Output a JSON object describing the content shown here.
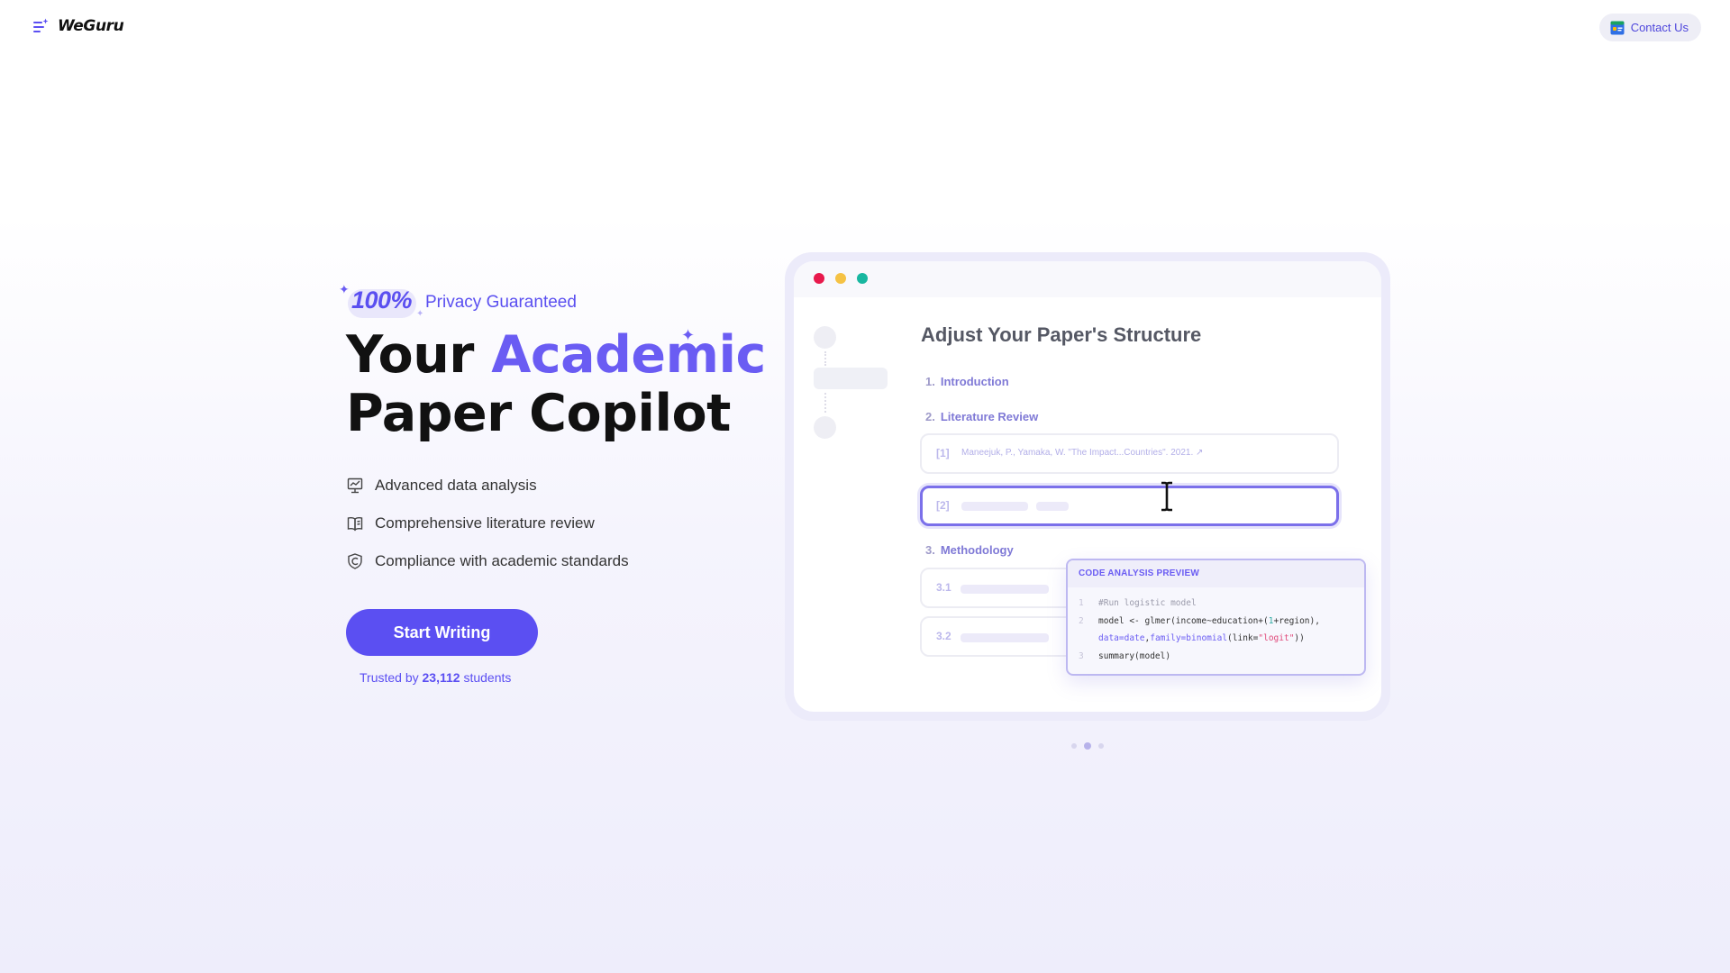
{
  "header": {
    "logo_text": "WeGuru",
    "contact_label": "Contact Us"
  },
  "hero": {
    "badge": {
      "number": "100%",
      "text": "Privacy Guaranteed"
    },
    "title_line1_prefix": "Your",
    "title_line1_accent": "Academic",
    "title_line2": "Paper Copilot",
    "features": [
      {
        "icon": "chart-presentation-icon",
        "label": "Advanced data analysis"
      },
      {
        "icon": "book-open-icon",
        "label": "Comprehensive literature review"
      },
      {
        "icon": "shield-check-icon",
        "label": "Compliance with academic standards"
      }
    ],
    "cta_label": "Start Writing",
    "trusted_prefix": "Trusted by",
    "trusted_count": "23,112",
    "trusted_suffix": "students"
  },
  "mock": {
    "heading": "Adjust Your Paper's Structure",
    "sections": [
      {
        "num": "1.",
        "label": "Introduction"
      },
      {
        "num": "2.",
        "label": "Literature Review"
      },
      {
        "num": "3.",
        "label": "Methodology"
      }
    ],
    "refs": [
      {
        "label": "[1]",
        "text": "Maneejuk, P., Yamaka, W. \"The Impact...Countries\". 2021. ↗"
      },
      {
        "label": "[2]"
      }
    ],
    "subsections": [
      {
        "label": "3.1"
      },
      {
        "label": "3.2"
      }
    ],
    "code_preview": {
      "title": "CODE ANALYSIS PREVIEW",
      "line_numbers": [
        "1",
        "2",
        "",
        "3"
      ],
      "lines": [
        "#Run logistic model",
        "model <- glmer(income~education+(1+region),",
        "data=date,family=binomial(link=\"logit\"))",
        "summary(model)"
      ]
    }
  },
  "pager": {
    "total": 3,
    "active_index": 1
  },
  "colors": {
    "accent": "#5b4ff2",
    "accent_light": "#6a5cf3",
    "dot_red": "#e8194c",
    "dot_yellow": "#f5c244",
    "dot_green": "#18b7a0"
  }
}
